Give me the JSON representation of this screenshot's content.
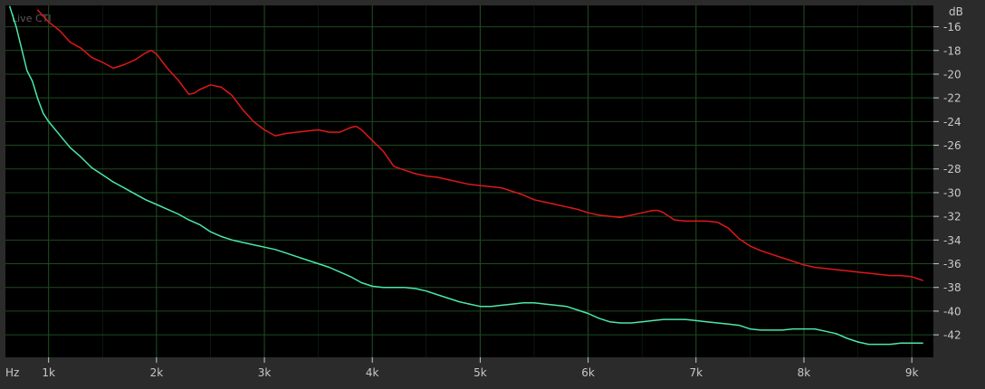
{
  "overlay_label": "Live CTI",
  "colors": {
    "background": "#000000",
    "frame": "#2b2b2b",
    "grid": "#1e4a1e",
    "series_red": "#e01818",
    "series_green": "#4be8a8",
    "text": "#c8c8c8"
  },
  "chart_data": {
    "type": "line",
    "title": "",
    "xlabel": "Hz",
    "ylabel": "dB",
    "xlim": [
      600,
      9200
    ],
    "ylim": [
      -43.9,
      -14.2
    ],
    "grid": true,
    "x_ticks": [
      1000,
      2000,
      3000,
      4000,
      5000,
      6000,
      7000,
      8000,
      9000
    ],
    "x_tick_labels": [
      "1k",
      "2k",
      "3k",
      "4k",
      "5k",
      "6k",
      "7k",
      "8k",
      "9k"
    ],
    "y_ticks": [
      -16,
      -18,
      -20,
      -22,
      -24,
      -26,
      -28,
      -30,
      -32,
      -34,
      -36,
      -38,
      -40,
      -42
    ],
    "y_tick_labels": [
      "-16",
      "-18",
      "-20",
      "-22",
      "-24",
      "-26",
      "-28",
      "-30",
      "-32",
      "-34",
      "-36",
      "-38",
      "-40",
      "-42"
    ],
    "series": [
      {
        "color": "#e01818",
        "x": [
          900,
          1000,
          1100,
          1200,
          1300,
          1400,
          1500,
          1600,
          1700,
          1800,
          1900,
          1950,
          2000,
          2100,
          2200,
          2300,
          2350,
          2400,
          2500,
          2600,
          2700,
          2800,
          2900,
          3000,
          3100,
          3200,
          3300,
          3400,
          3500,
          3600,
          3700,
          3800,
          3850,
          3900,
          4000,
          4100,
          4200,
          4300,
          4400,
          4500,
          4600,
          4700,
          4800,
          4900,
          5000,
          5100,
          5200,
          5300,
          5400,
          5500,
          5600,
          5700,
          5800,
          5900,
          6000,
          6100,
          6200,
          6300,
          6400,
          6500,
          6600,
          6650,
          6700,
          6800,
          6900,
          7000,
          7100,
          7200,
          7300,
          7400,
          7500,
          7600,
          7700,
          7800,
          7900,
          8000,
          8100,
          8200,
          8300,
          8400,
          8500,
          8600,
          8700,
          8800,
          8900,
          9000,
          9100
        ],
        "y": [
          -14.6,
          -15.6,
          -16.3,
          -17.3,
          -17.8,
          -18.6,
          -19.0,
          -19.5,
          -19.2,
          -18.8,
          -18.2,
          -18.0,
          -18.3,
          -19.5,
          -20.5,
          -21.7,
          -21.6,
          -21.3,
          -20.9,
          -21.1,
          -21.8,
          -23.0,
          -24.0,
          -24.7,
          -25.2,
          -25.0,
          -24.9,
          -24.8,
          -24.7,
          -24.9,
          -24.9,
          -24.5,
          -24.4,
          -24.7,
          -25.6,
          -26.5,
          -27.8,
          -28.1,
          -28.4,
          -28.6,
          -28.7,
          -28.9,
          -29.1,
          -29.3,
          -29.4,
          -29.5,
          -29.6,
          -29.9,
          -30.2,
          -30.6,
          -30.8,
          -31.0,
          -31.2,
          -31.4,
          -31.7,
          -31.9,
          -32.0,
          -32.1,
          -31.9,
          -31.7,
          -31.5,
          -31.5,
          -31.7,
          -32.3,
          -32.4,
          -32.4,
          -32.4,
          -32.5,
          -33.0,
          -33.9,
          -34.5,
          -34.9,
          -35.2,
          -35.5,
          -35.8,
          -36.1,
          -36.3,
          -36.4,
          -36.5,
          -36.6,
          -36.7,
          -36.8,
          -36.9,
          -37.0,
          -37.0,
          -37.1,
          -37.4
        ]
      },
      {
        "color": "#4be8a8",
        "x": [
          640,
          700,
          800,
          850,
          900,
          950,
          1000,
          1100,
          1200,
          1300,
          1400,
          1500,
          1600,
          1700,
          1800,
          1900,
          2000,
          2100,
          2200,
          2300,
          2400,
          2500,
          2600,
          2700,
          2800,
          2900,
          3000,
          3100,
          3200,
          3300,
          3400,
          3500,
          3600,
          3700,
          3800,
          3900,
          4000,
          4100,
          4200,
          4300,
          4400,
          4500,
          4600,
          4700,
          4800,
          4900,
          5000,
          5100,
          5200,
          5300,
          5400,
          5500,
          5600,
          5700,
          5800,
          5900,
          6000,
          6100,
          6200,
          6300,
          6400,
          6500,
          6600,
          6700,
          6800,
          6900,
          7000,
          7100,
          7200,
          7300,
          7400,
          7500,
          7600,
          7700,
          7800,
          7900,
          8000,
          8100,
          8200,
          8300,
          8400,
          8500,
          8600,
          8700,
          8800,
          8900,
          9000,
          9100
        ],
        "y": [
          -14.3,
          -16.0,
          -19.7,
          -20.6,
          -22.1,
          -23.3,
          -24.0,
          -25.1,
          -26.2,
          -27.0,
          -27.9,
          -28.5,
          -29.1,
          -29.6,
          -30.1,
          -30.6,
          -31.0,
          -31.4,
          -31.8,
          -32.3,
          -32.7,
          -33.3,
          -33.7,
          -34.0,
          -34.2,
          -34.4,
          -34.6,
          -34.8,
          -35.1,
          -35.4,
          -35.7,
          -36.0,
          -36.3,
          -36.7,
          -37.1,
          -37.6,
          -37.9,
          -38.0,
          -38.0,
          -38.0,
          -38.1,
          -38.3,
          -38.6,
          -38.9,
          -39.2,
          -39.4,
          -39.6,
          -39.6,
          -39.5,
          -39.4,
          -39.3,
          -39.3,
          -39.4,
          -39.5,
          -39.6,
          -39.9,
          -40.2,
          -40.6,
          -40.9,
          -41.0,
          -41.0,
          -40.9,
          -40.8,
          -40.7,
          -40.7,
          -40.7,
          -40.8,
          -40.9,
          -41.0,
          -41.1,
          -41.2,
          -41.5,
          -41.6,
          -41.6,
          -41.6,
          -41.5,
          -41.5,
          -41.5,
          -41.7,
          -41.9,
          -42.3,
          -42.6,
          -42.8,
          -42.8,
          -42.8,
          -42.7,
          -42.7,
          -42.7
        ]
      }
    ]
  }
}
